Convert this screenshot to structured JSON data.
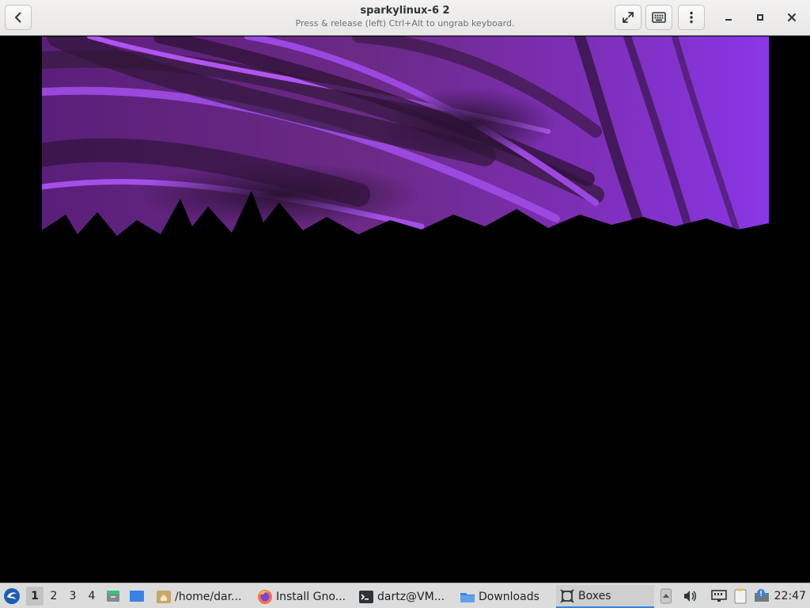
{
  "window": {
    "title": "sparkylinux-6 2",
    "subtitle": "Press & release (left) Ctrl+Alt to ungrab keyboard."
  },
  "icons": {
    "back": "back-arrow-icon",
    "fullscreen": "fullscreen-icon",
    "keyboard": "keyboard-icon",
    "menu": "kebab-menu-icon",
    "minimize": "minimize-icon",
    "maximize": "maximize-icon",
    "close": "close-icon"
  },
  "taskbar": {
    "workspaces": [
      "1",
      "2",
      "3",
      "4"
    ],
    "active_workspace": "1",
    "tasks": [
      {
        "label": "/home/dar...",
        "icon": "folder-home-icon"
      },
      {
        "label": "Install Gno...",
        "icon": "firefox-icon"
      },
      {
        "label": "dartz@VM...",
        "icon": "terminal-icon"
      },
      {
        "label": "Downloads",
        "icon": "folder-icon"
      },
      {
        "label": "Boxes",
        "icon": "boxes-icon"
      }
    ],
    "active_task": "Boxes",
    "clock": "22:47"
  },
  "colors": {
    "accent": "#3584e4",
    "wallpaper_purple": "#8a2be2"
  }
}
